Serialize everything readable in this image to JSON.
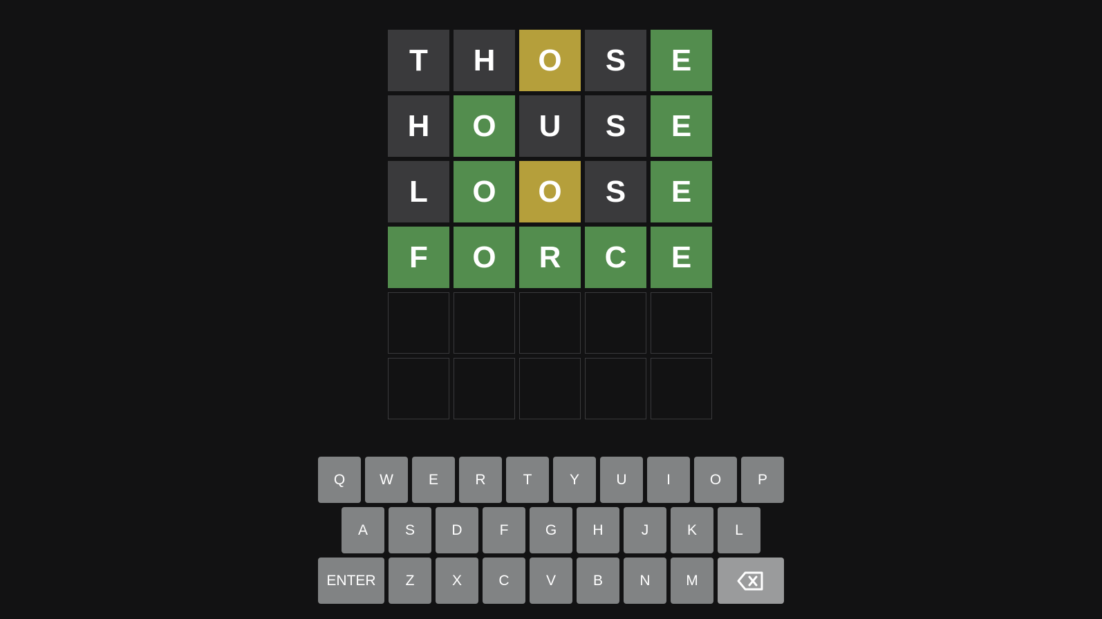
{
  "board": {
    "rows": [
      [
        {
          "letter": "T",
          "state": "absent"
        },
        {
          "letter": "H",
          "state": "absent"
        },
        {
          "letter": "O",
          "state": "present"
        },
        {
          "letter": "S",
          "state": "absent"
        },
        {
          "letter": "E",
          "state": "correct"
        }
      ],
      [
        {
          "letter": "H",
          "state": "absent"
        },
        {
          "letter": "O",
          "state": "correct"
        },
        {
          "letter": "U",
          "state": "absent"
        },
        {
          "letter": "S",
          "state": "absent"
        },
        {
          "letter": "E",
          "state": "correct"
        }
      ],
      [
        {
          "letter": "L",
          "state": "absent"
        },
        {
          "letter": "O",
          "state": "correct"
        },
        {
          "letter": "O",
          "state": "present"
        },
        {
          "letter": "S",
          "state": "absent"
        },
        {
          "letter": "E",
          "state": "correct"
        }
      ],
      [
        {
          "letter": "F",
          "state": "correct"
        },
        {
          "letter": "O",
          "state": "correct"
        },
        {
          "letter": "R",
          "state": "correct"
        },
        {
          "letter": "C",
          "state": "correct"
        },
        {
          "letter": "E",
          "state": "correct"
        }
      ],
      [
        {
          "letter": "",
          "state": "empty"
        },
        {
          "letter": "",
          "state": "empty"
        },
        {
          "letter": "",
          "state": "empty"
        },
        {
          "letter": "",
          "state": "empty"
        },
        {
          "letter": "",
          "state": "empty"
        }
      ],
      [
        {
          "letter": "",
          "state": "empty"
        },
        {
          "letter": "",
          "state": "empty"
        },
        {
          "letter": "",
          "state": "empty"
        },
        {
          "letter": "",
          "state": "empty"
        },
        {
          "letter": "",
          "state": "empty"
        }
      ]
    ]
  },
  "keyboard": {
    "rows": [
      [
        "Q",
        "W",
        "E",
        "R",
        "T",
        "Y",
        "U",
        "I",
        "O",
        "P"
      ],
      [
        "A",
        "S",
        "D",
        "F",
        "G",
        "H",
        "J",
        "K",
        "L"
      ],
      [
        "ENTER",
        "Z",
        "X",
        "C",
        "V",
        "B",
        "N",
        "M",
        "BACKSPACE"
      ]
    ],
    "backspace_icon": "backspace-icon"
  },
  "colors": {
    "background": "#121213",
    "absent": "#3a3a3c",
    "present": "#b59f3b",
    "correct": "#538d4e",
    "key": "#818384",
    "text": "#ffffff"
  }
}
